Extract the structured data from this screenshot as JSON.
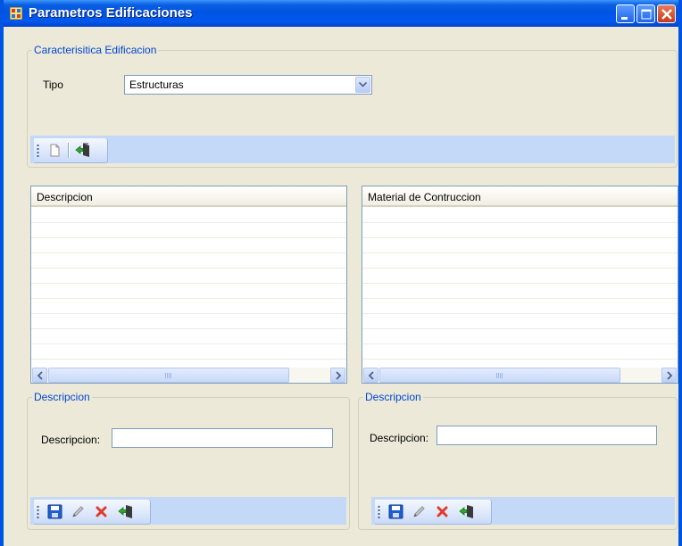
{
  "window": {
    "title": "Parametros Edificaciones"
  },
  "caracteristica": {
    "legend": "Caracterisitica Edificacion",
    "tipo_label": "Tipo",
    "tipo_value": "Estructuras"
  },
  "list_left": {
    "header": "Descripcion",
    "scroll_thumb_grip": "III"
  },
  "list_right": {
    "header": "Material de Contruccion",
    "scroll_thumb_grip": "III"
  },
  "group_left": {
    "legend": "Descripcion",
    "field_label": "Descripcion:",
    "field_value": ""
  },
  "group_right": {
    "legend": "Descripcion",
    "field_label": "Descripcion:",
    "field_value": ""
  },
  "icons": {
    "new": "new-document-icon",
    "exit": "exit-door-icon",
    "save": "save-icon",
    "edit": "pencil-edit-icon",
    "delete": "delete-x-icon"
  },
  "colors": {
    "title_bar": "#0054e3",
    "legend_text": "#0046d5",
    "toolstrip": "#c4d8f8",
    "background": "#ece9d8"
  }
}
